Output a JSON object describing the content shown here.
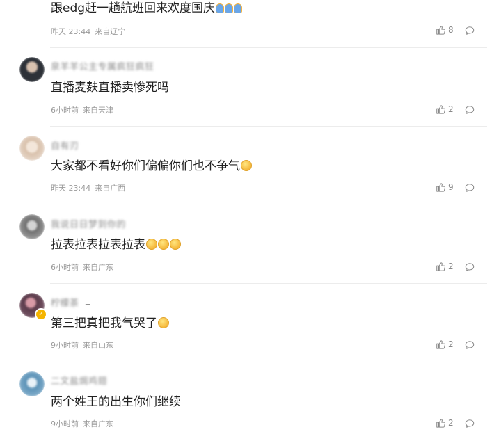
{
  "comments": [
    {
      "text": "跟edg赶一趟航班回来欢度国庆",
      "emojis": [
        "blue",
        "blue",
        "blue"
      ],
      "time": "昨天 23:44",
      "location": "来自辽宁",
      "likes": "8"
    },
    {
      "username": "泉羊羊公主专属疯狂疯狂",
      "text": "直播麦麸直播卖惨死吗",
      "emojis": [],
      "time": "6小时前",
      "location": "来自天津",
      "likes": "2",
      "avatar_color": "#3b4048"
    },
    {
      "username": "自有刃",
      "text": "大家都不看好你们偏偏你们也不争气",
      "emojis": [
        "yellow"
      ],
      "time": "昨天 23:44",
      "location": "来自广西",
      "likes": "9",
      "avatar_color": "#e8d6c7"
    },
    {
      "username": "我说日日梦到你的",
      "text": "拉表拉表拉表拉表",
      "emojis": [
        "yellow",
        "yellow",
        "yellow"
      ],
      "time": "6小时前",
      "location": "来自广东",
      "likes": "2",
      "avatar_color": "#7a7a7a"
    },
    {
      "username": "柠檬茶",
      "username_suffix": "_",
      "text": "第三把真把我气哭了",
      "emojis": [
        "yellow"
      ],
      "time": "9小时前",
      "location": "来自山东",
      "likes": "2",
      "avatar_color": "#6b4a58",
      "verified": true
    },
    {
      "username": "二文盐焗鸡翅",
      "text": "两个姓王的出生你们继续",
      "emojis": [],
      "time": "9小时前",
      "location": "来自广东",
      "likes": "2",
      "avatar_color": "#5b92b7"
    }
  ],
  "icons": {
    "like": "thumbs-up-icon",
    "reply": "comment-bubble-icon",
    "verified": "verified-badge-icon"
  },
  "colors": {
    "text": "#222222",
    "meta": "#9a9a9a",
    "username": "#8a8a8a",
    "verified": "#f5b400"
  }
}
